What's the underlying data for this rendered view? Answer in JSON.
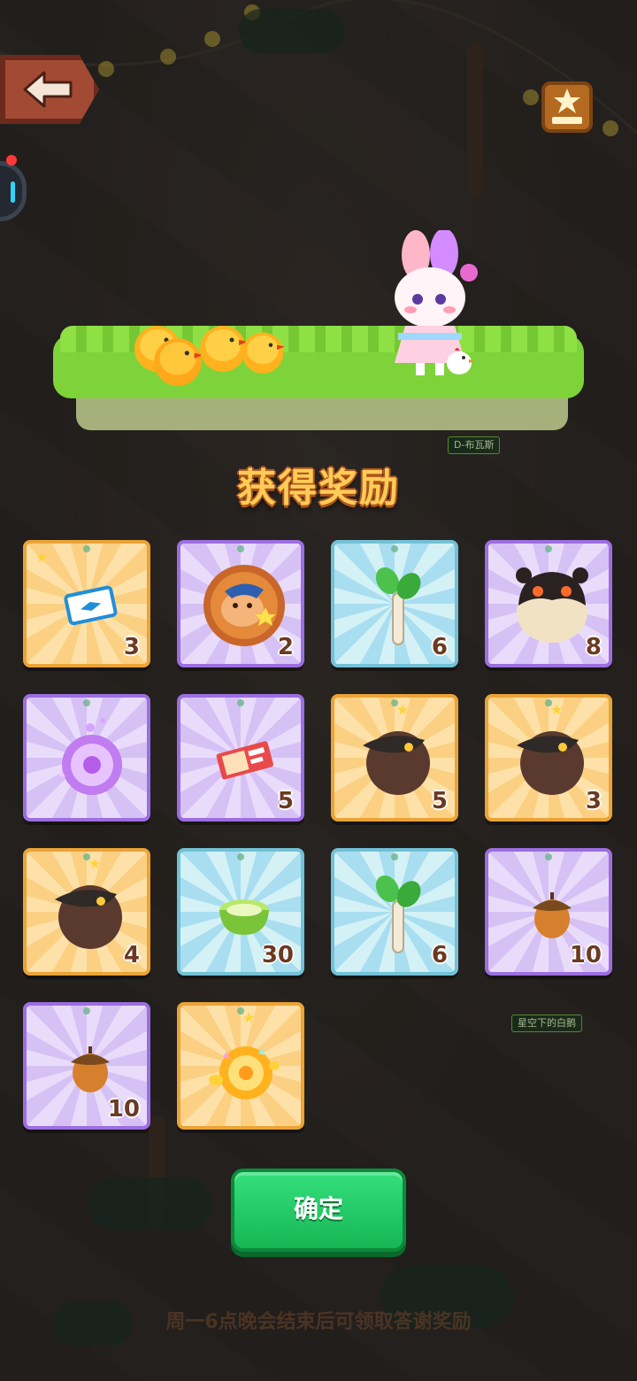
{
  "title": "获得奖励",
  "confirm_label": "确定",
  "footer_note": "周一6点晚会结束后可领取答谢奖励",
  "background_tags": [
    "D-布瓦斯",
    "星空下的白鹅"
  ],
  "rewards": [
    {
      "item": "ticket-icon",
      "rarity": "orange",
      "count": "3"
    },
    {
      "item": "bear-coin-icon",
      "rarity": "purple",
      "count": "2"
    },
    {
      "item": "sapling-icon",
      "rarity": "blue",
      "count": "6"
    },
    {
      "item": "beast-egg-icon",
      "rarity": "purple",
      "count": "8"
    },
    {
      "item": "magic-orb-icon",
      "rarity": "purple",
      "count": ""
    },
    {
      "item": "coupon-icon",
      "rarity": "purple",
      "count": "5"
    },
    {
      "item": "crow-egg-icon",
      "rarity": "orange",
      "count": "5"
    },
    {
      "item": "crow-egg-icon",
      "rarity": "orange",
      "count": "3"
    },
    {
      "item": "crow-egg-icon",
      "rarity": "orange",
      "count": "4"
    },
    {
      "item": "tea-bowl-icon",
      "rarity": "blue",
      "count": "30"
    },
    {
      "item": "sapling-icon",
      "rarity": "blue",
      "count": "6"
    },
    {
      "item": "acorn-icon",
      "rarity": "purple",
      "count": "10"
    },
    {
      "item": "acorn-icon",
      "rarity": "purple",
      "count": "10"
    },
    {
      "item": "golden-orb-icon",
      "rarity": "orange",
      "count": ""
    }
  ],
  "colors": {
    "accent_green": "#17b655",
    "title_gold": "#ffcc58"
  }
}
